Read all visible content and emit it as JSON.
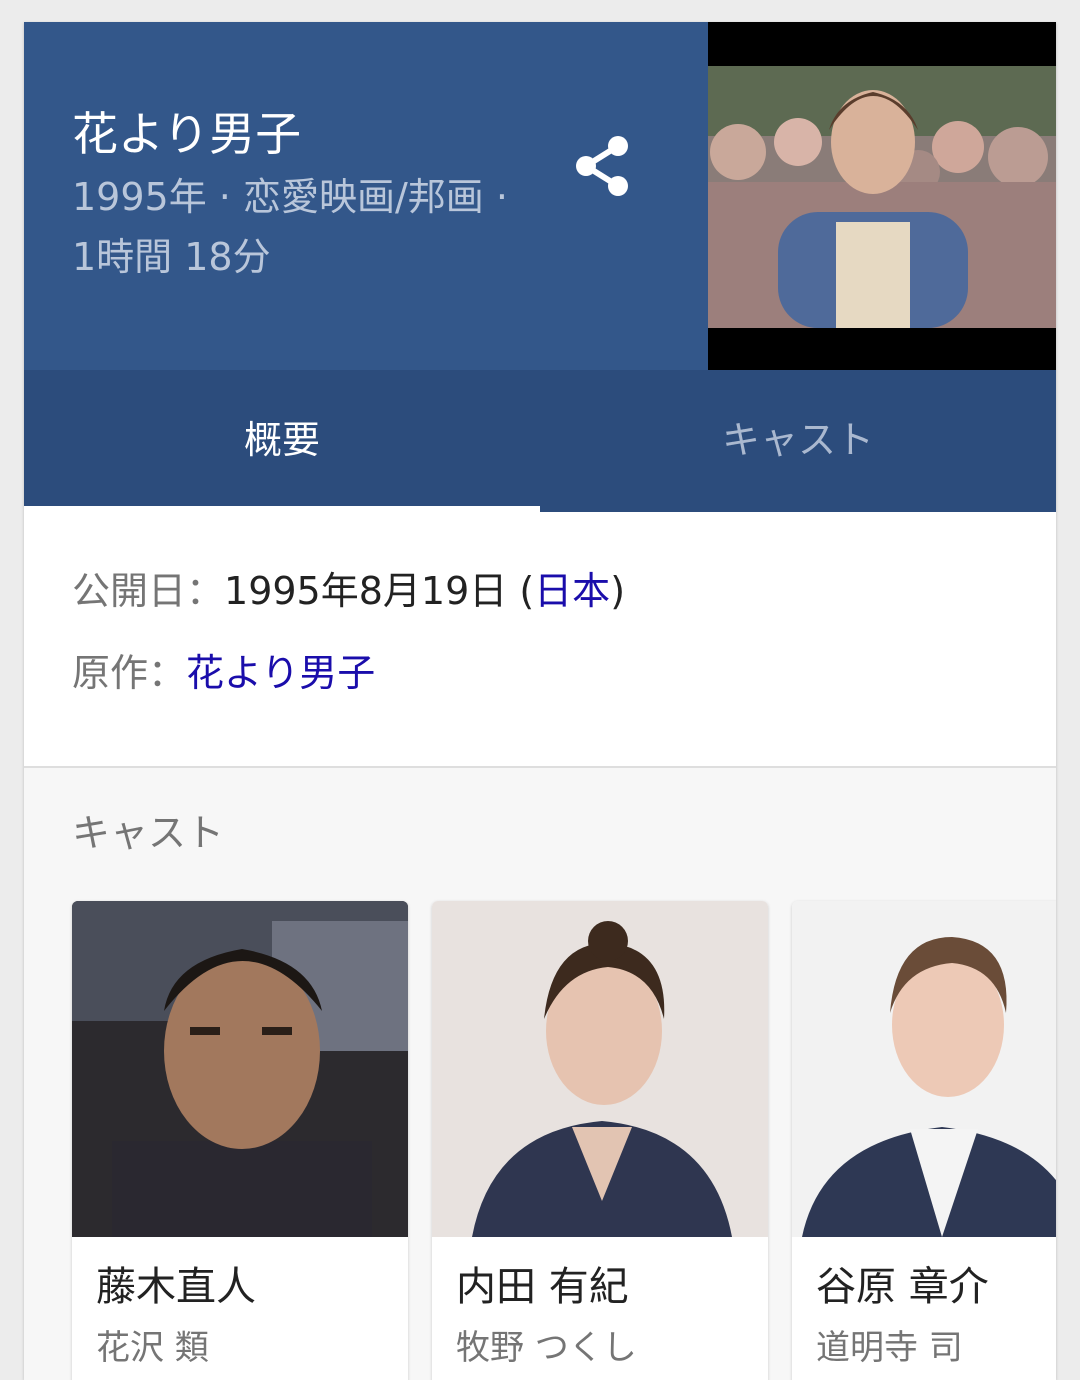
{
  "header": {
    "title": "花より男子",
    "meta_line1": "1995年 · 恋愛映画/邦画 ·",
    "meta_line2": "1時間 18分",
    "share_icon": "share-icon",
    "thumbnail_description": "movie-still"
  },
  "tabs": [
    {
      "label": "概要",
      "active": true
    },
    {
      "label": "キャスト",
      "active": false
    }
  ],
  "info": {
    "release": {
      "label": "公開日：",
      "value": "1995年8月19日 (",
      "link": "日本",
      "suffix": ")"
    },
    "original": {
      "label": "原作：",
      "link": "花より男子"
    }
  },
  "cast": {
    "heading": "キャスト",
    "members": [
      {
        "name": "藤木直人",
        "role": "花沢 類"
      },
      {
        "name": "内田 有紀",
        "role": "牧野 つくし"
      },
      {
        "name": "谷原 章介",
        "role": "道明寺 司"
      }
    ]
  },
  "colors": {
    "header_bg": "#33578a",
    "tab_bg": "#2c4c7c",
    "link": "#1a0dab"
  }
}
